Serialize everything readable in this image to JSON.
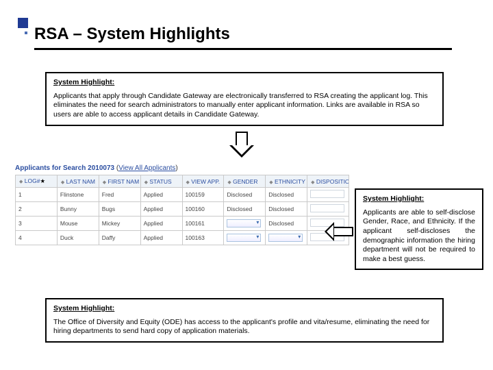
{
  "title": "RSA – System Highlights",
  "callouts": {
    "c1": {
      "heading": "System Highlight:",
      "body": "Applicants that apply through Candidate Gateway are electronically transferred to RSA creating the applicant log.  This eliminates the need for search administrators to manually enter applicant information.  Links are available in RSA so users are able to access applicant details in Candidate Gateway."
    },
    "c2": {
      "heading": "System Highlight:",
      "body": "Applicants are able to self-disclose Gender, Race, and Ethnicity.  If the applicant self-discloses the demographic information the hiring department will not be required to make a best guess."
    },
    "c3": {
      "heading": "System Highlight:",
      "body": "The Office of Diversity and Equity (ODE) has access to the applicant's profile and vita/resume, eliminating the need for hiring departments to send hard copy of application materials."
    }
  },
  "applicantsPanel": {
    "titlePrefix": "Applicants for Search ",
    "searchId": "2010073",
    "viewAllText": "View All Applicants",
    "columns": [
      "LOG#",
      "LAST NAM",
      "FIRST NAM",
      "STATUS",
      "VIEW APP.",
      "GENDER",
      "ETHNICITY",
      "DISPOSITIO"
    ],
    "rows": [
      {
        "log": "1",
        "last": "Flinstone",
        "first": "Fred",
        "status": "Applied",
        "view": "100159",
        "gender": "Disclosed",
        "ethnicity": "Disclosed",
        "dispo": "input"
      },
      {
        "log": "2",
        "last": "Bunny",
        "first": "Bugs",
        "status": "Applied",
        "view": "100160",
        "gender": "Disclosed",
        "ethnicity": "Disclosed",
        "dispo": "input"
      },
      {
        "log": "3",
        "last": "Mouse",
        "first": "Mickey",
        "status": "Applied",
        "view": "100161",
        "gender": "dropdown",
        "ethnicity": "Disclosed",
        "dispo": "input"
      },
      {
        "log": "4",
        "last": "Duck",
        "first": "Daffy",
        "status": "Applied",
        "view": "100163",
        "gender": "dropdown",
        "ethnicity": "dropdown",
        "dispo": "input"
      }
    ]
  }
}
